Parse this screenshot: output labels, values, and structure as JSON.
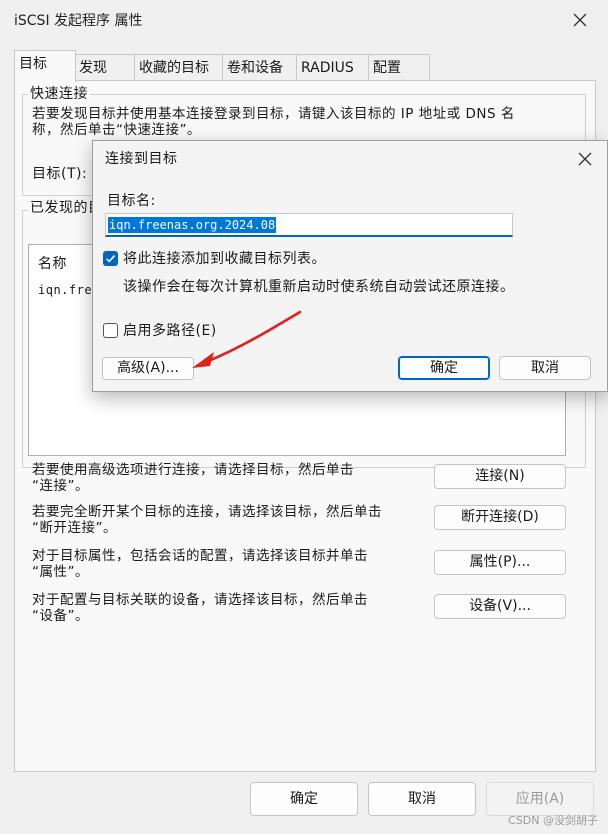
{
  "window": {
    "title": "iSCSI 发起程序 属性"
  },
  "tabs": [
    {
      "label": "目标"
    },
    {
      "label": "发现"
    },
    {
      "label": "收藏的目标"
    },
    {
      "label": "卷和设备"
    },
    {
      "label": "RADIUS"
    },
    {
      "label": "配置"
    }
  ],
  "quick_connect": {
    "legend": "快速连接",
    "desc_line1": "若要发现目标并使用基本连接登录到目标，请键入该目标的 IP 地址或 DNS 名",
    "desc_line2": "称，然后单击“快速连接”。",
    "target_label": "目标(T):"
  },
  "discovered": {
    "legend": "已发现的目",
    "col_name": "名称",
    "row1_name": "iqn.fre"
  },
  "actions": [
    {
      "text_line1": "若要使用高级选项进行连接，请选择目标，然后单击",
      "text_line2": "“连接”。",
      "button": "连接(N)"
    },
    {
      "text_line1": "若要完全断开某个目标的连接，请选择该目标，然后单击",
      "text_line2": "“断开连接”。",
      "button": "断开连接(D)"
    },
    {
      "text_line1": "对于目标属性，包括会话的配置，请选择该目标并单击",
      "text_line2": "“属性”。",
      "button": "属性(P)..."
    },
    {
      "text_line1": "对于配置与目标关联的设备，请选择该目标，然后单击",
      "text_line2": "“设备”。",
      "button": "设备(V)..."
    }
  ],
  "footer": {
    "ok": "确定",
    "cancel": "取消",
    "apply": "应用(A)"
  },
  "dialog": {
    "title": "连接到目标",
    "target_name_label": "目标名:",
    "target_name_value": "iqn.freenas.org.2024.08",
    "add_favorites_label": "将此连接添加到收藏目标列表。",
    "add_favorites_checked": true,
    "add_favorites_note": "该操作会在每次计算机重新启动时使系统自动尝试还原连接。",
    "multipath_label": "启用多路径(E)",
    "multipath_checked": false,
    "advanced_button": "高级(A)...",
    "ok_button": "确定",
    "cancel_button": "取消"
  },
  "watermark": "CSDN @没剑胡子",
  "colors": {
    "accent": "#0067c0",
    "arrow": "#e0201a"
  }
}
